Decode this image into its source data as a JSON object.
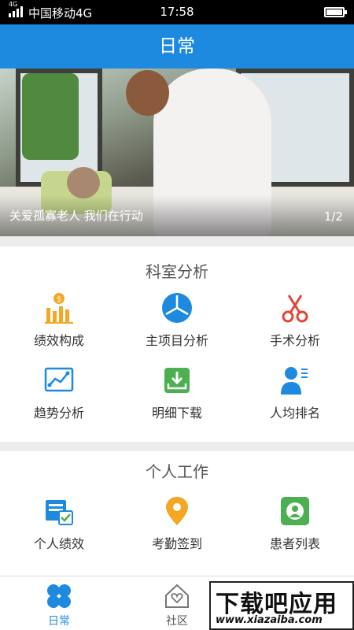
{
  "status_bar": {
    "network_tag": "4G",
    "carrier": "中国移动4G",
    "time": "17:58",
    "battery_icon": "battery-full-icon",
    "signal_icon": "signal-bars-icon"
  },
  "header": {
    "title": "日常"
  },
  "banner": {
    "caption": "关爱孤寡老人 我们在行动",
    "pager": "1/2"
  },
  "department_analysis": {
    "title": "科室分析",
    "items": [
      {
        "label": "绩效构成",
        "icon": "performance-chart-icon"
      },
      {
        "label": "主项目分析",
        "icon": "pie-chart-icon"
      },
      {
        "label": "手术分析",
        "icon": "scissors-icon"
      },
      {
        "label": "趋势分析",
        "icon": "trend-line-icon"
      },
      {
        "label": "明细下载",
        "icon": "download-tray-icon"
      },
      {
        "label": "人均排名",
        "icon": "user-ranking-icon"
      }
    ]
  },
  "personal_work": {
    "title": "个人工作",
    "items": [
      {
        "label": "个人绩效",
        "icon": "personal-performance-icon"
      },
      {
        "label": "考勤签到",
        "icon": "location-pin-icon"
      },
      {
        "label": "患者列表",
        "icon": "patient-list-icon"
      }
    ]
  },
  "tab_bar": {
    "tabs": [
      {
        "label": "日常",
        "icon": "clover-icon",
        "active": true
      },
      {
        "label": "社区",
        "icon": "house-heart-icon",
        "active": false
      }
    ]
  },
  "watermark": {
    "main": "下载吧应用",
    "url": "www.xiazaiba.com"
  },
  "colors": {
    "primary": "#1d8ae0",
    "orange": "#f5a623",
    "red": "#e0463a",
    "green": "#4caf50"
  }
}
